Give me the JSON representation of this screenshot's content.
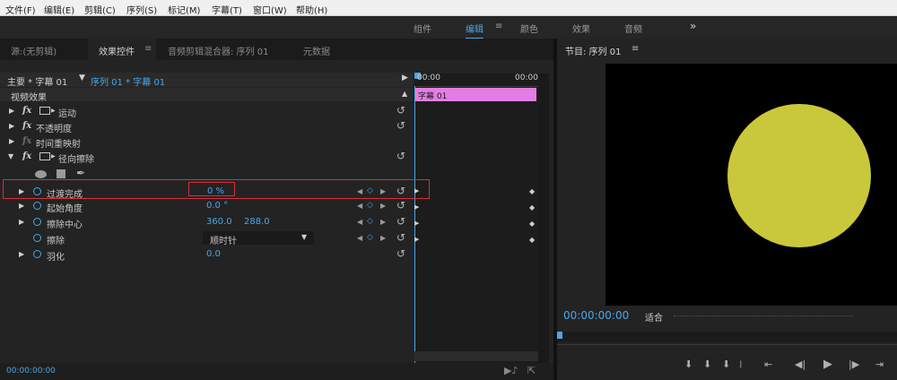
{
  "menubar": {
    "items": [
      "文件(F)",
      "编辑(E)",
      "剪辑(C)",
      "序列(S)",
      "标记(M)",
      "字幕(T)",
      "窗口(W)",
      "帮助(H)"
    ]
  },
  "workspace": {
    "tabs": [
      "组件",
      "编辑",
      "颜色",
      "效果",
      "音频"
    ],
    "active": "编辑",
    "more": "»",
    "menu": "≡"
  },
  "left_panel": {
    "tabs": [
      "源:(无剪辑)",
      "效果控件",
      "音频剪辑混合器: 序列 01",
      "元数据"
    ],
    "active_tab_menu": "≡",
    "master_label": "主要 * 字幕 01",
    "sequence_label": "序列 01 * 字幕 01",
    "timecode_start": "00:00",
    "timecode_end": "00:00",
    "clip_label": "字幕 01",
    "section_title": "视频效果",
    "effects": [
      {
        "name": "运动"
      },
      {
        "name": "不透明度"
      },
      {
        "name": "时间重映射"
      },
      {
        "name": "径向擦除"
      }
    ],
    "params": [
      {
        "name": "过渡完成",
        "value": "0 %"
      },
      {
        "name": "起始角度",
        "value": "0.0 °"
      },
      {
        "name": "擦除中心",
        "value": "360.0",
        "value2": "288.0"
      },
      {
        "name": "擦除",
        "value": "顺时针"
      },
      {
        "name": "羽化",
        "value": "0.0"
      }
    ],
    "bottom_timecode": "00:00:00:00"
  },
  "program_panel": {
    "title": "节目: 序列 01",
    "menu": "≡",
    "timecode": "00:00:00:00",
    "fit": "适合",
    "colors": {
      "circle": "#c9c83a",
      "clip": "#e27ee3",
      "accent": "#4aa6e8"
    }
  }
}
